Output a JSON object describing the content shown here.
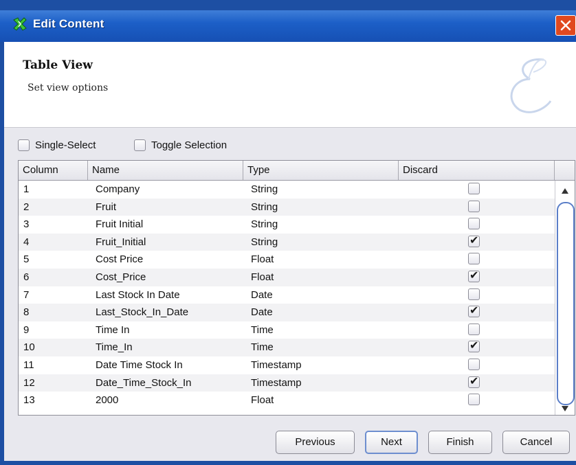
{
  "window": {
    "title": "Edit Content"
  },
  "header": {
    "title": "Table View",
    "subtitle": "Set view options"
  },
  "options": {
    "single_select": "Single-Select",
    "toggle_selection": "Toggle Selection"
  },
  "table": {
    "columns": [
      "Column",
      "Name",
      "Type",
      "Discard"
    ],
    "rows": [
      {
        "column": "1",
        "name": "Company",
        "type": "String",
        "discard": false
      },
      {
        "column": "2",
        "name": "Fruit",
        "type": "String",
        "discard": false
      },
      {
        "column": "3",
        "name": "Fruit Initial",
        "type": "String",
        "discard": false
      },
      {
        "column": "4",
        "name": "Fruit_Initial",
        "type": "String",
        "discard": true
      },
      {
        "column": "5",
        "name": "Cost Price",
        "type": "Float",
        "discard": false
      },
      {
        "column": "6",
        "name": "Cost_Price",
        "type": "Float",
        "discard": true
      },
      {
        "column": "7",
        "name": "Last Stock In Date",
        "type": "Date",
        "discard": false
      },
      {
        "column": "8",
        "name": "Last_Stock_In_Date",
        "type": "Date",
        "discard": true
      },
      {
        "column": "9",
        "name": "Time In",
        "type": "Time",
        "discard": false
      },
      {
        "column": "10",
        "name": "Time_In",
        "type": "Time",
        "discard": true
      },
      {
        "column": "11",
        "name": "Date Time Stock In",
        "type": "Timestamp",
        "discard": false
      },
      {
        "column": "12",
        "name": "Date_Time_Stock_In",
        "type": "Timestamp",
        "discard": true
      },
      {
        "column": "13",
        "name": "2000",
        "type": "Float",
        "discard": false
      }
    ]
  },
  "buttons": {
    "previous": "Previous",
    "next": "Next",
    "finish": "Finish",
    "cancel": "Cancel"
  },
  "colors": {
    "title_bar": "#1c5fc7",
    "close_button": "#e0491f",
    "scroll_thumb_border": "#5a7ec8"
  },
  "icons": {
    "app": "x-logo-icon",
    "close": "close-icon",
    "watermark": "script-e-logo"
  }
}
